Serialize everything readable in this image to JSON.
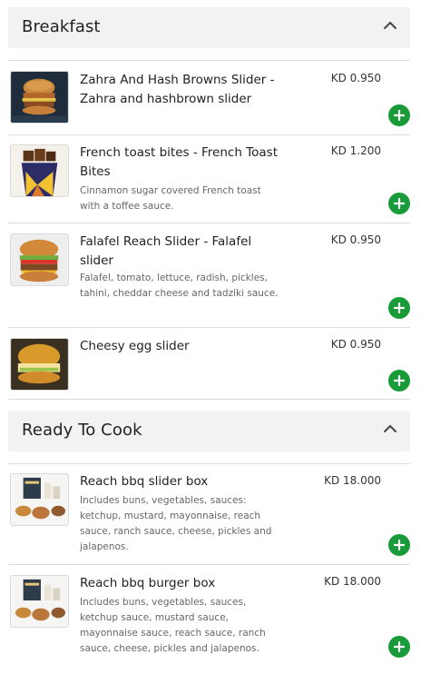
{
  "sections": [
    {
      "title": "Breakfast",
      "items": [
        {
          "name": "Zahra And Hash Browns Slider - Zahra and hashbrown slider",
          "description": "",
          "price": "KD 0.950",
          "image": "burger-hashbrown-image"
        },
        {
          "name": "French toast bites - French Toast Bites",
          "description": "Cinnamon sugar covered French toast with a toffee sauce.",
          "price": "KD 1.200",
          "image": "french-toast-cup-image"
        },
        {
          "name": "Falafel Reach Slider - Falafel slider",
          "description": "Falafel, tomato, lettuce, radish, pickles, tahini, cheddar cheese and tadziki sauce.",
          "price": "KD 0.950",
          "image": "falafel-slider-image"
        },
        {
          "name": "Cheesy egg slider",
          "description": "",
          "price": "KD 0.950",
          "image": "egg-slider-image"
        }
      ]
    },
    {
      "title": "Ready To Cook",
      "items": [
        {
          "name": "Reach bbq slider box",
          "description": "Includes buns, vegetables, sauces: ketchup, mustard, mayonnaise, reach sauce, ranch sauce, cheese, pickles and jalapenos.",
          "price": "KD 18.000",
          "image": "bbq-box-image"
        },
        {
          "name": "Reach bbq burger box",
          "description": "Includes buns, vegetables, sauces, ketchup sauce, mustard sauce, mayonnaise sauce, reach sauce, ranch sauce, cheese, pickles and jalapenos.",
          "price": "KD 18.000",
          "image": "bbq-box-image"
        }
      ]
    }
  ],
  "colors": {
    "add_button": "#1a9b3a",
    "header_bg": "#f2f2f2"
  },
  "icons": {
    "collapse": "chevron-up-icon",
    "add": "plus-icon"
  }
}
